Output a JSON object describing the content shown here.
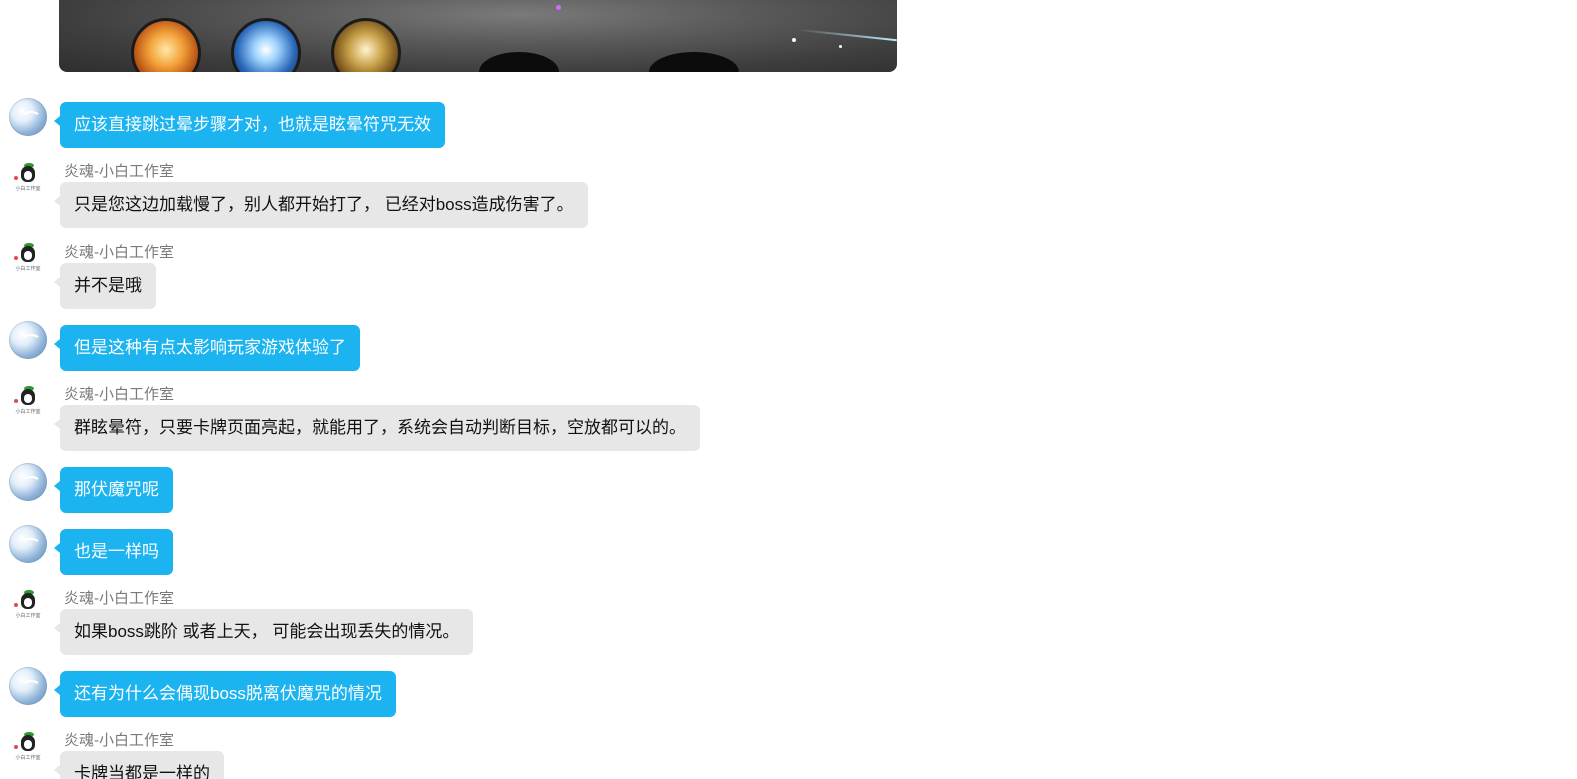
{
  "shared_image": {
    "description_icon": "game-screenshot"
  },
  "contact_name": "炎魂-小白工作室",
  "contact_avatar_caption": "小白工作室",
  "messages": [
    {
      "from": "me",
      "text": "应该直接跳过晕步骤才对，也就是眩晕符咒无效"
    },
    {
      "from": "them",
      "sender": "炎魂-小白工作室",
      "text": "只是您这边加载慢了，别人都开始打了， 已经对boss造成伤害了。"
    },
    {
      "from": "them",
      "sender": "炎魂-小白工作室",
      "text": "并不是哦"
    },
    {
      "from": "me",
      "text": "但是这种有点太影响玩家游戏体验了"
    },
    {
      "from": "them",
      "sender": "炎魂-小白工作室",
      "text": "群眩晕符，只要卡牌页面亮起，就能用了，系统会自动判断目标，空放都可以的。"
    },
    {
      "from": "me",
      "text": "那伏魔咒呢"
    },
    {
      "from": "me",
      "text": "也是一样吗"
    },
    {
      "from": "them",
      "sender": "炎魂-小白工作室",
      "text": "如果boss跳阶 或者上天， 可能会出现丢失的情况。"
    },
    {
      "from": "me",
      "text": "还有为什么会偶现boss脱离伏魔咒的情况"
    },
    {
      "from": "them",
      "sender": "炎魂-小白工作室",
      "text": "卡牌当都是一样的"
    }
  ],
  "colors": {
    "my_bubble": "#1bb4f0",
    "their_bubble": "#e7e7e7",
    "sender_name": "#7a7a7a"
  }
}
